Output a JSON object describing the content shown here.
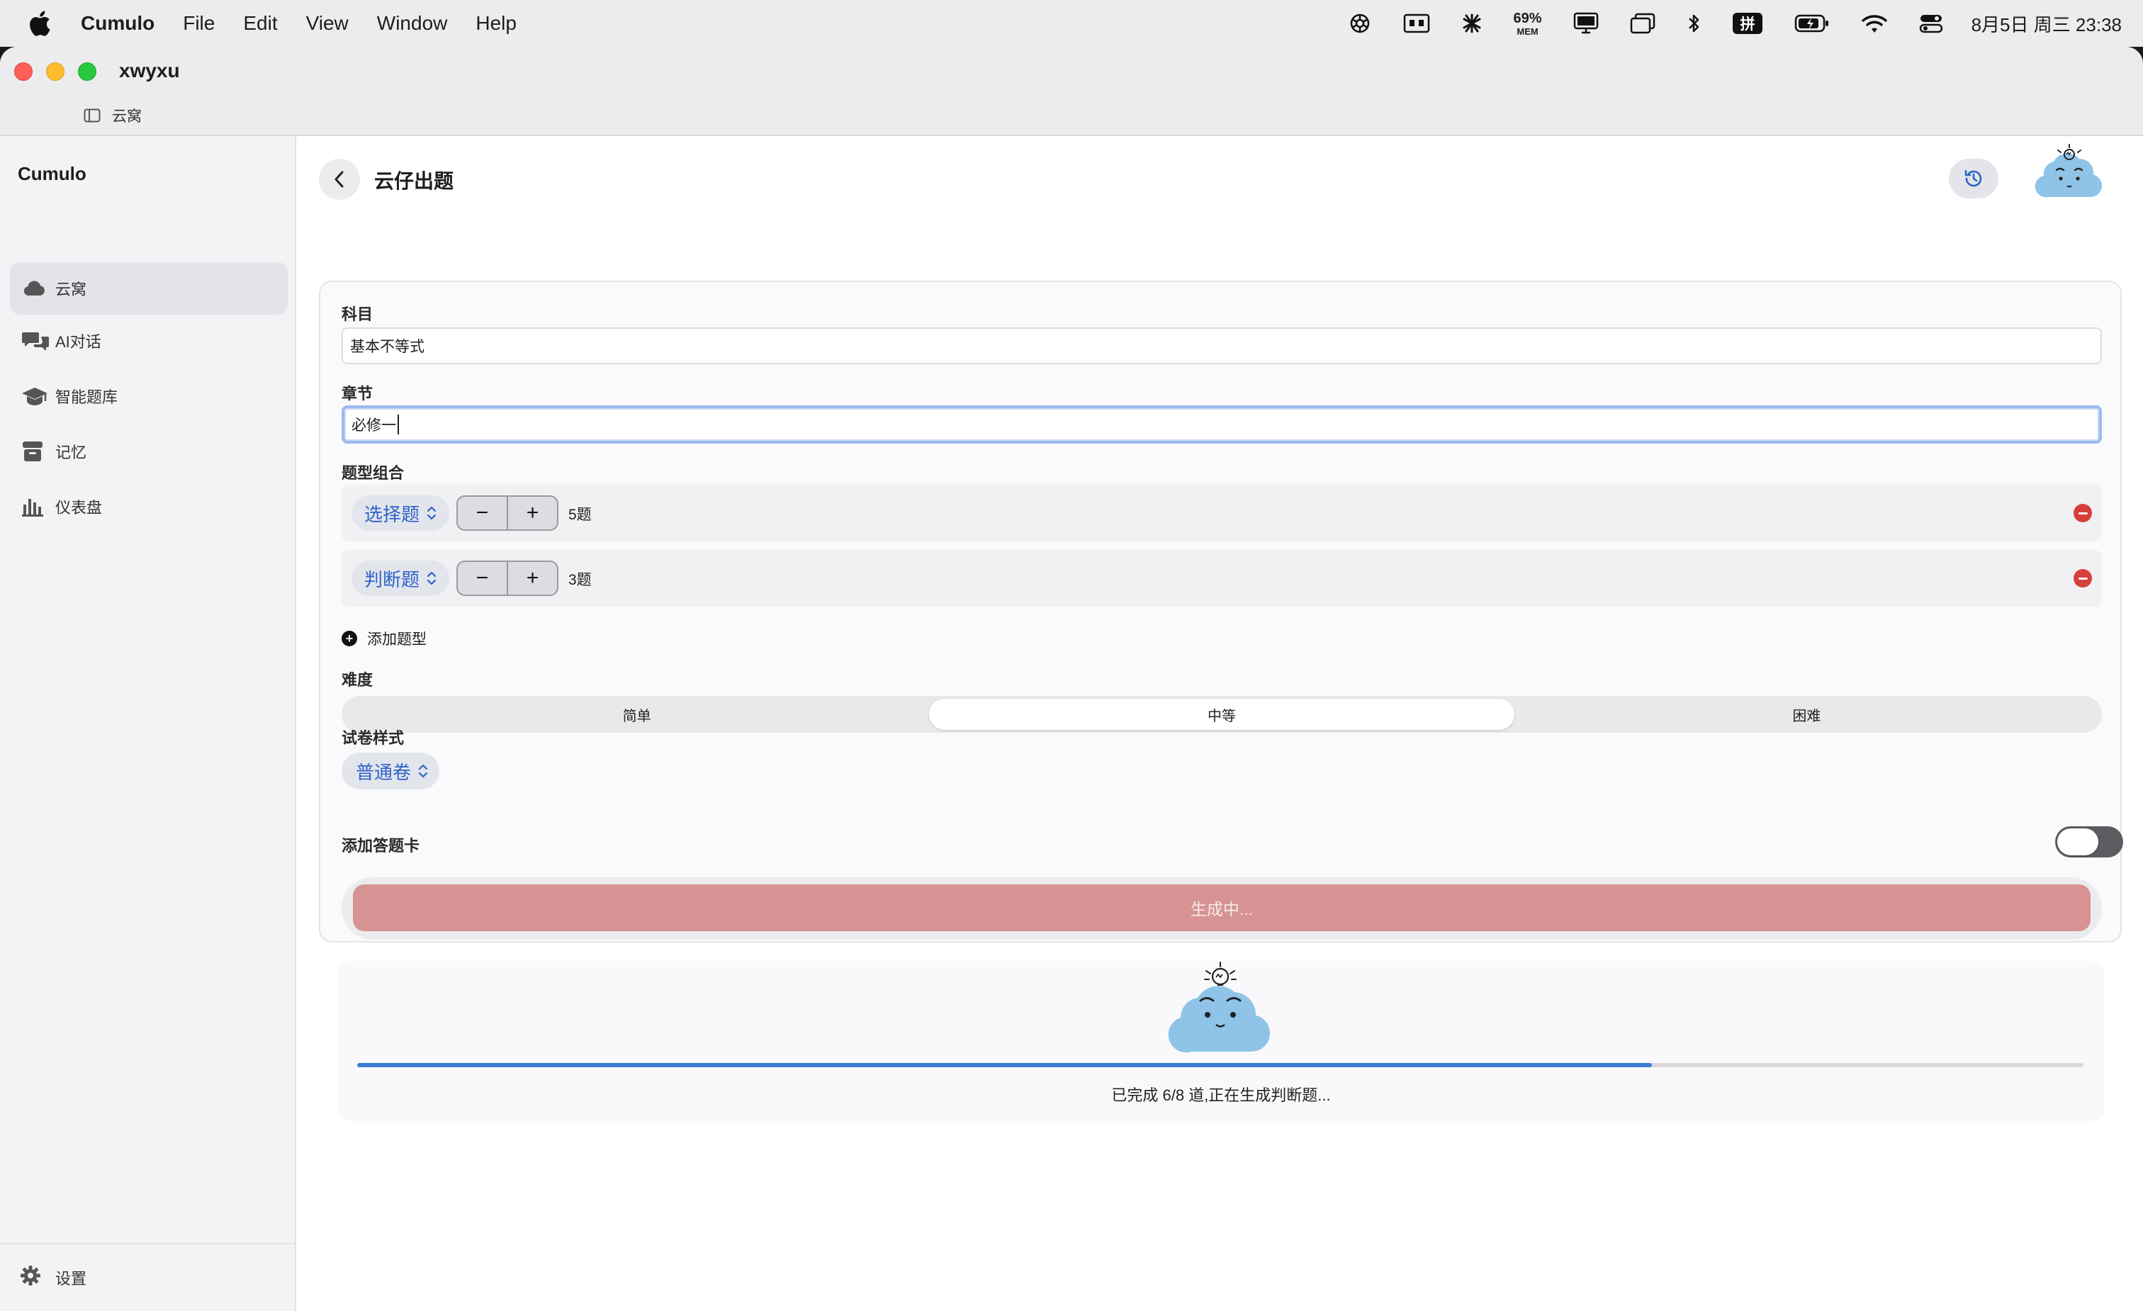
{
  "menubar": {
    "app_name": "Cumulo",
    "items": [
      "File",
      "Edit",
      "View",
      "Window",
      "Help"
    ],
    "mem_percent": "69%",
    "mem_label": "MEM",
    "input_method": "拼",
    "clock": "8月5日 周三 23:38"
  },
  "window": {
    "title": "xwyxu",
    "breadcrumb": "云窝"
  },
  "sidebar": {
    "brand": "Cumulo",
    "items": [
      {
        "label": "云窝",
        "icon": "cloud-icon"
      },
      {
        "label": "AI对话",
        "icon": "chat-bubbles-icon"
      },
      {
        "label": "智能题库",
        "icon": "graduation-cap-icon"
      },
      {
        "label": "记忆",
        "icon": "archive-box-icon"
      },
      {
        "label": "仪表盘",
        "icon": "bar-chart-icon"
      }
    ],
    "settings_label": "设置"
  },
  "header": {
    "title": "云仔出题"
  },
  "form": {
    "subject_label": "科目",
    "subject_value": "基本不等式",
    "chapter_label": "章节",
    "chapter_value": "必修一",
    "types_label": "题型组合",
    "question_types": [
      {
        "type": "选择题",
        "count_text": "5题",
        "count": 5
      },
      {
        "type": "判断题",
        "count_text": "3题",
        "count": 3
      }
    ],
    "add_type_label": "添加题型",
    "difficulty_label": "难度",
    "difficulty_options": [
      "简单",
      "中等",
      "困难"
    ],
    "difficulty_selected": "中等",
    "paper_style_label": "试卷样式",
    "paper_style_value": "普通卷",
    "answer_card_label": "添加答题卡",
    "answer_card_on": false,
    "generate_label": "生成中..."
  },
  "progress": {
    "completed": 6,
    "total": 8,
    "fraction": 0.75,
    "text": "已完成 6/8 道,正在生成判断题..."
  },
  "colors": {
    "accent": "#2d63c8",
    "progress": "#3a7bd5",
    "generate_button": "#d79393",
    "remove": "#d63f3a",
    "mascot": "#8fc4e8"
  }
}
